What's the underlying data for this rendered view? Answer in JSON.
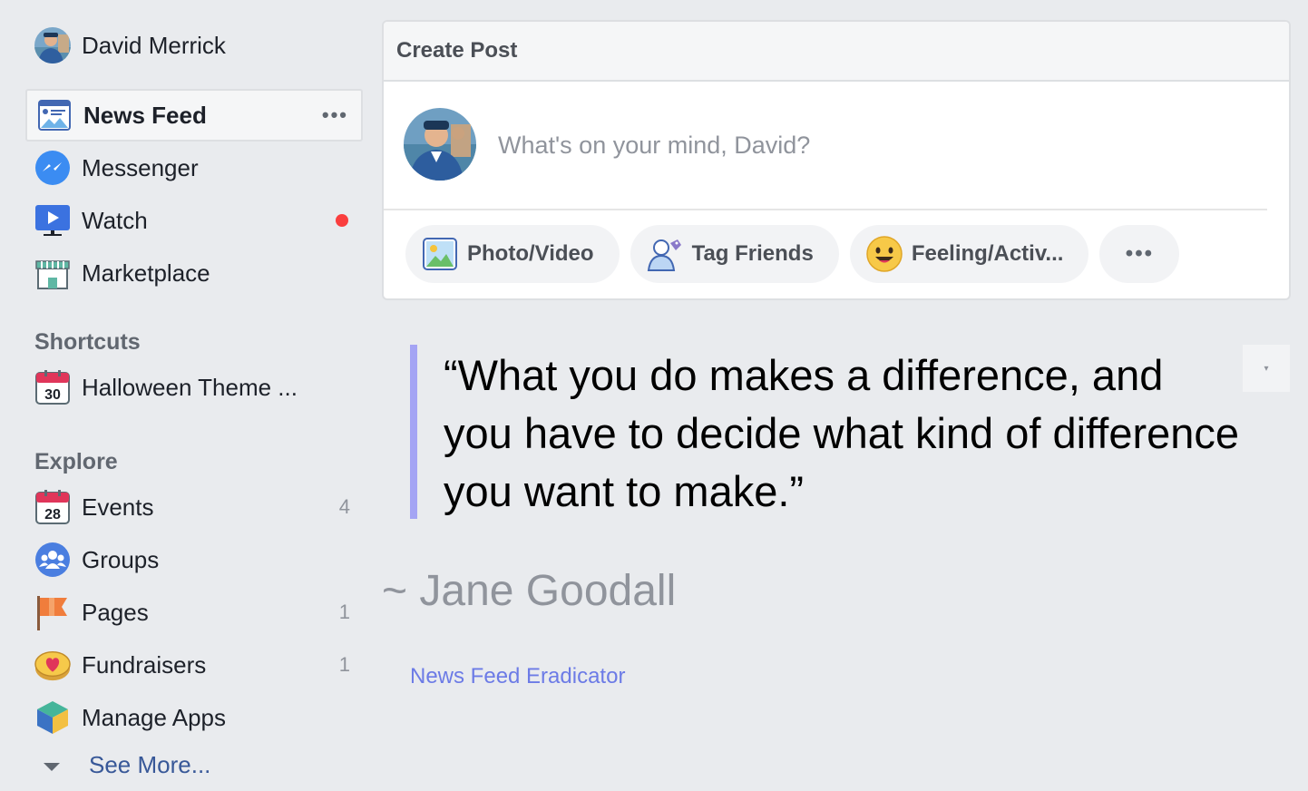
{
  "profile": {
    "name": "David Merrick"
  },
  "nav": [
    {
      "label": "News Feed",
      "icon": "news-feed-icon",
      "active": true,
      "extra": "•••"
    },
    {
      "label": "Messenger",
      "icon": "messenger-icon"
    },
    {
      "label": "Watch",
      "icon": "watch-icon",
      "notification": true
    },
    {
      "label": "Marketplace",
      "icon": "marketplace-icon"
    }
  ],
  "shortcuts": {
    "title": "Shortcuts",
    "items": [
      {
        "label": "Halloween Theme ...",
        "icon": "calendar-icon",
        "date": "30"
      }
    ]
  },
  "explore": {
    "title": "Explore",
    "items": [
      {
        "label": "Events",
        "icon": "calendar-icon",
        "date": "28",
        "count": "4"
      },
      {
        "label": "Groups",
        "icon": "groups-icon",
        "count": ""
      },
      {
        "label": "Pages",
        "icon": "flag-icon",
        "count": "1"
      },
      {
        "label": "Fundraisers",
        "icon": "fundraiser-icon",
        "count": "1"
      },
      {
        "label": "Manage Apps",
        "icon": "cube-icon",
        "count": ""
      }
    ],
    "see_more": "See More..."
  },
  "create_post": {
    "title": "Create Post",
    "placeholder": "What's on your mind, David?",
    "actions": [
      {
        "label": "Photo/Video",
        "icon": "photo-icon"
      },
      {
        "label": "Tag Friends",
        "icon": "tag-friends-icon"
      },
      {
        "label": "Feeling/Activ...",
        "icon": "smiley-icon"
      }
    ],
    "more": "•••"
  },
  "quote": {
    "text": "“What you do makes a difference, and you have to decide what kind of difference you want to make.”",
    "author": "~ Jane Goodall",
    "toggle": "▾",
    "bar_color": "#a4a4f4"
  },
  "footer_link": "News Feed Eradicator",
  "colors": {
    "background": "#e9ebee",
    "link": "#385898",
    "accent": "#6c7be6",
    "notification": "#fa3e3e"
  }
}
